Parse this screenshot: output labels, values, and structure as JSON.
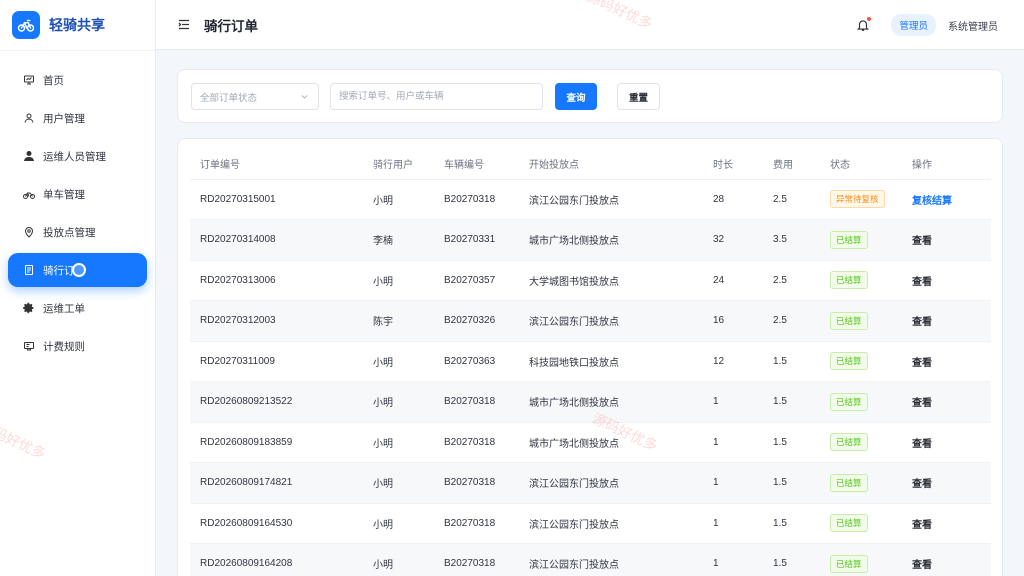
{
  "app": {
    "name": "轻骑共享"
  },
  "sidebar": {
    "items": [
      {
        "label": "首页",
        "icon": "monitor-icon"
      },
      {
        "label": "用户管理",
        "icon": "user-icon"
      },
      {
        "label": "运维人员管理",
        "icon": "user-solid-icon"
      },
      {
        "label": "单车管理",
        "icon": "bicycle-icon"
      },
      {
        "label": "投放点管理",
        "icon": "location-icon"
      },
      {
        "label": "骑行订",
        "icon": "document-icon",
        "active": true
      },
      {
        "label": "运维工单",
        "icon": "gear-icon"
      },
      {
        "label": "计费规则",
        "icon": "ticket-icon"
      }
    ]
  },
  "header": {
    "title": "骑行订单",
    "role": "管理员",
    "user": "系统管理员"
  },
  "filters": {
    "status_placeholder": "全部订单状态",
    "search_placeholder": "搜索订单号、用户或车辆",
    "query_label": "查询",
    "reset_label": "重置"
  },
  "table": {
    "columns": [
      "订单编号",
      "骑行用户",
      "车辆编号",
      "开始投放点",
      "时长",
      "费用",
      "状态",
      "操作"
    ],
    "rows": [
      {
        "id": "RD20270315001",
        "user": "小明",
        "bike": "B20270318",
        "point": "滨江公园东门投放点",
        "duration": "28",
        "fee": "2.5",
        "status": "异常待复核",
        "status_type": "warn",
        "action": "复核结算"
      },
      {
        "id": "RD20270314008",
        "user": "李楠",
        "bike": "B20270331",
        "point": "城市广场北侧投放点",
        "duration": "32",
        "fee": "3.5",
        "status": "已结算",
        "status_type": "done",
        "action": "查看"
      },
      {
        "id": "RD20270313006",
        "user": "小明",
        "bike": "B20270357",
        "point": "大学城图书馆投放点",
        "duration": "24",
        "fee": "2.5",
        "status": "已结算",
        "status_type": "done",
        "action": "查看"
      },
      {
        "id": "RD20270312003",
        "user": "陈宇",
        "bike": "B20270326",
        "point": "滨江公园东门投放点",
        "duration": "16",
        "fee": "2.5",
        "status": "已结算",
        "status_type": "done",
        "action": "查看"
      },
      {
        "id": "RD20270311009",
        "user": "小明",
        "bike": "B20270363",
        "point": "科技园地铁口投放点",
        "duration": "12",
        "fee": "1.5",
        "status": "已结算",
        "status_type": "done",
        "action": "查看"
      },
      {
        "id": "RD20260809213522",
        "user": "小明",
        "bike": "B20270318",
        "point": "城市广场北侧投放点",
        "duration": "1",
        "fee": "1.5",
        "status": "已结算",
        "status_type": "done",
        "action": "查看"
      },
      {
        "id": "RD20260809183859",
        "user": "小明",
        "bike": "B20270318",
        "point": "城市广场北侧投放点",
        "duration": "1",
        "fee": "1.5",
        "status": "已结算",
        "status_type": "done",
        "action": "查看"
      },
      {
        "id": "RD20260809174821",
        "user": "小明",
        "bike": "B20270318",
        "point": "滨江公园东门投放点",
        "duration": "1",
        "fee": "1.5",
        "status": "已结算",
        "status_type": "done",
        "action": "查看"
      },
      {
        "id": "RD20260809164530",
        "user": "小明",
        "bike": "B20270318",
        "point": "滨江公园东门投放点",
        "duration": "1",
        "fee": "1.5",
        "status": "已结算",
        "status_type": "done",
        "action": "查看"
      },
      {
        "id": "RD20260809164208",
        "user": "小明",
        "bike": "B20270318",
        "point": "滨江公园东门投放点",
        "duration": "1",
        "fee": "1.5",
        "status": "已结算",
        "status_type": "done",
        "action": "查看"
      }
    ]
  },
  "watermark": "源码好优多",
  "colors": {
    "primary": "#1677ff",
    "success": "#52c41a",
    "warning": "#fa8c16"
  }
}
